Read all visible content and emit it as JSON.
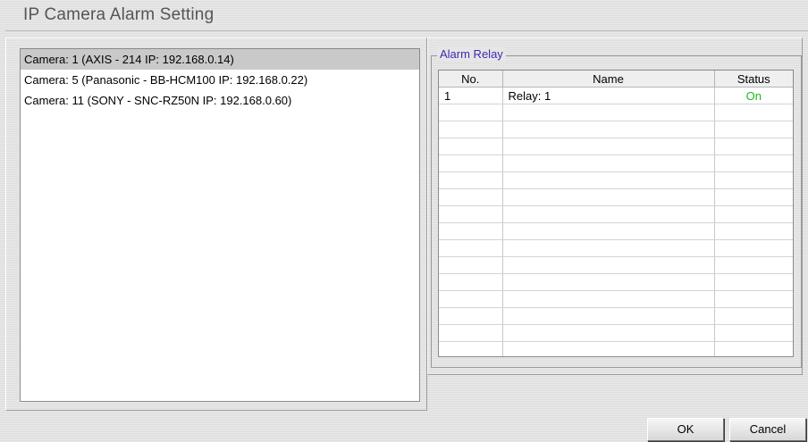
{
  "window": {
    "title": "IP Camera Alarm Setting"
  },
  "cameras": [
    {
      "label": "Camera: 1 (AXIS - 214 IP: 192.168.0.14)",
      "selected": true
    },
    {
      "label": "Camera: 5 (Panasonic - BB-HCM100 IP: 192.168.0.22)",
      "selected": false
    },
    {
      "label": "Camera: 11 (SONY - SNC-RZ50N IP: 192.168.0.60)",
      "selected": false
    }
  ],
  "alarm_relay": {
    "group_label": "Alarm Relay",
    "columns": [
      "No.",
      "Name",
      "Status"
    ],
    "rows": [
      {
        "no": "1",
        "name": "Relay: 1",
        "status": "On"
      }
    ],
    "status_on_color": "#17b817"
  },
  "buttons": {
    "ok": "OK",
    "cancel": "Cancel"
  }
}
